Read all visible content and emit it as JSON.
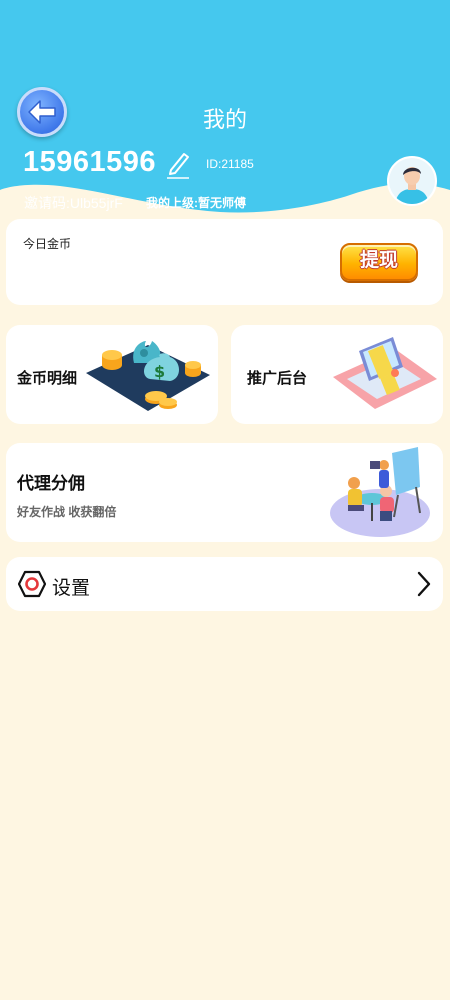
{
  "header": {
    "title": "我的",
    "phone": "15961596",
    "id_text": "ID:21185",
    "invite_text": "邀请码:Ulb55jrF",
    "superior_text": "我的上级:暂无师傅"
  },
  "gold": {
    "label": "今日金币",
    "withdraw_label": "提现"
  },
  "menu": {
    "coins_detail": "金币明细",
    "promo_backend": "推广后台",
    "agent_title": "代理分佣",
    "agent_subtitle": "好友作战 收获翻倍",
    "settings": "设置"
  },
  "colors": {
    "header_bg": "#45c8ee",
    "page_bg": "#fef6e2",
    "card_bg": "#ffffff",
    "withdraw_btn": "#ffb300",
    "back_btn": "#3f78ea"
  },
  "icons": [
    "back-arrow-icon",
    "edit-pencil-icon",
    "avatar",
    "settings-hexagon-icon",
    "chevron-right-icon"
  ]
}
